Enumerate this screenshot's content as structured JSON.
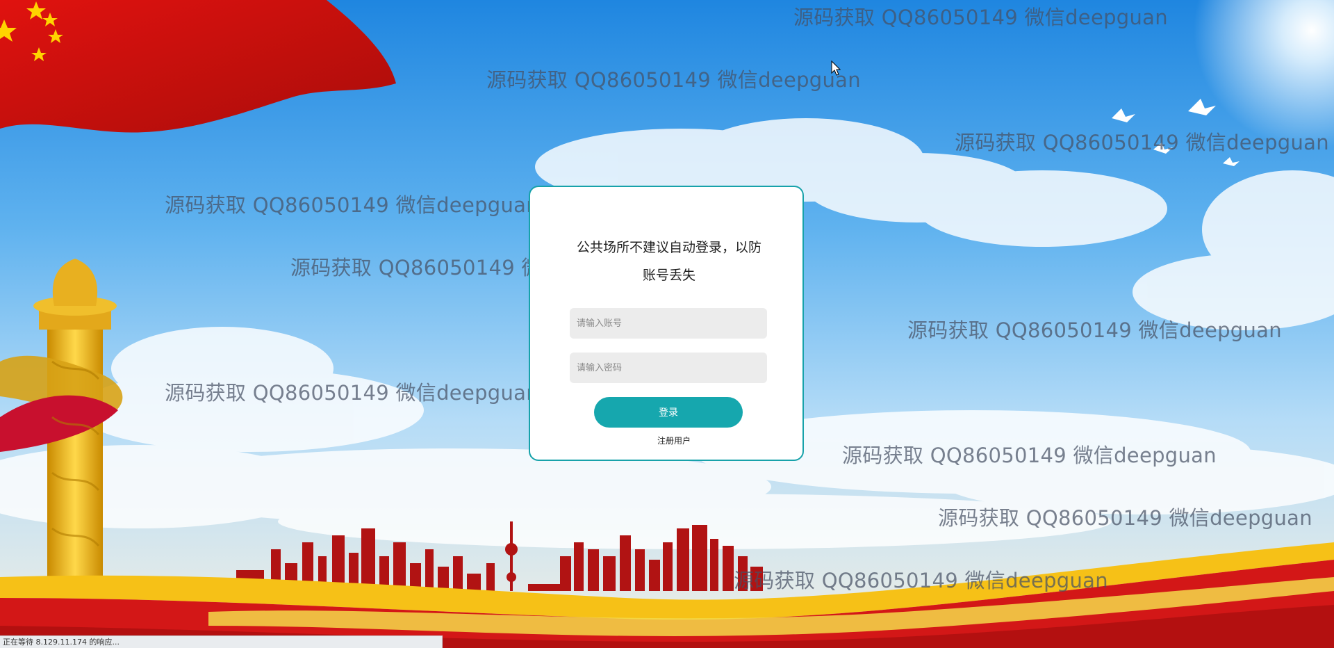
{
  "login": {
    "notice": "公共场所不建议自动登录，以防账号丢失",
    "username_placeholder": "请输入账号",
    "password_placeholder": "请输入密码",
    "login_label": "登录",
    "register_label": "注册用户"
  },
  "watermark_text": "源码获取 QQ86050149 微信deepguan",
  "status_bar": {
    "text": "正在等待 8.129.11.174 的响应..."
  },
  "colors": {
    "accent": "#16a7ae",
    "card_border": "#17a2aa",
    "flag_red": "#d90f0f",
    "sky_blue": "#2f95e6"
  }
}
